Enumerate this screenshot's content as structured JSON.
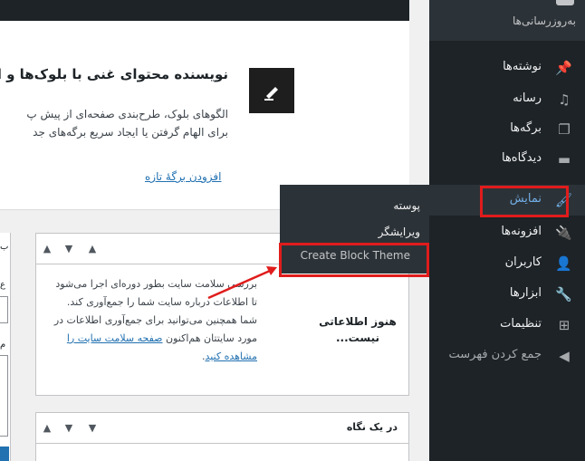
{
  "sidebar": {
    "site_name": "به‌روزرسانی‌ها",
    "items": [
      {
        "label": "نوشته‌ها",
        "icon": "pin-icon"
      },
      {
        "label": "رسانه",
        "icon": "media-icon"
      },
      {
        "label": "برگه‌ها",
        "icon": "pages-icon"
      },
      {
        "label": "دیدگاه‌ها",
        "icon": "comments-icon"
      },
      {
        "label": "نمایش",
        "icon": "appearance-icon"
      },
      {
        "label": "افزونه‌ها",
        "icon": "plugins-icon"
      },
      {
        "label": "کاربران",
        "icon": "users-icon"
      },
      {
        "label": "ابزارها",
        "icon": "tools-icon"
      },
      {
        "label": "تنظیمات",
        "icon": "settings-icon"
      },
      {
        "label": "جمع کردن فهرست",
        "icon": "collapse-icon"
      }
    ]
  },
  "flyout": {
    "items": [
      "پوسته",
      "ویرایشگر",
      "Create Block Theme"
    ]
  },
  "welcome": {
    "title": "نویسنده محتوای غنی با بلوک‌ها و الگ",
    "text_line1": "الگوهای بلوک، طرح‌بندی صفحه‌ای از پیش پ",
    "text_line2": "برای الهام گرفتن یا ایجاد سریع برگه‌های جد",
    "link": "افزودن برگهٔ تازه"
  },
  "site_health": {
    "empty_title": "هنوز اطلاعاتی نیست...",
    "text": "بررسی سلامت سایت بطور دوره‌ای اجرا می‌شود تا اطلاعات درباره سایت شما را جمع‌آوری کند. شما همچنین می‌توانید برای جمع‌آوری اطلاعات در مورد سایتتان هم‌اکنون",
    "link": "صفحه سلامت سایت را مشاهده کنید",
    "link_end": "."
  },
  "at_a_glance": {
    "title": "در یک نگاه"
  },
  "left_box": {
    "frag1": "ب",
    "frag2": "ع",
    "frag3": "م"
  },
  "colors": {
    "sidebar_bg": "#1d2327",
    "submenu_bg": "#2c3338",
    "highlight_red": "#e01c1c",
    "link_blue": "#2271b1",
    "current_blue": "#72aee6"
  }
}
